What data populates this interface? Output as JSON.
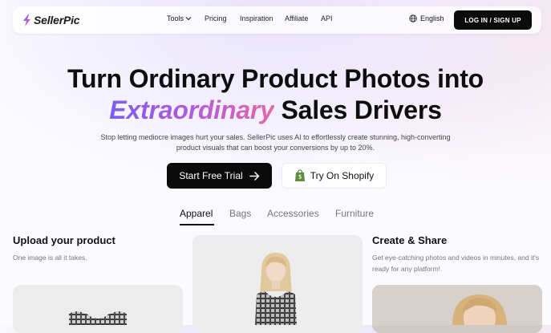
{
  "brand": {
    "name": "SellerPic",
    "accent": "#7b5cf0"
  },
  "nav": {
    "tools": "Tools",
    "pricing": "Pricing",
    "inspiration": "Inspiration",
    "affiliate": "Affiliate",
    "api": "API",
    "language": "English",
    "login": "LOG IN / SIGN UP"
  },
  "hero": {
    "line1": "Turn Ordinary Product Photos into",
    "highlight": "Extraordinary",
    "line2_rest": "Sales Drivers",
    "subtitle": "Stop letting mediocre images hurt your sales. SellerPic uses AI to effortlessly create stunning, high-converting product visuals that can boost your conversions by up to 20%.",
    "primary_cta": "Start Free Trial",
    "secondary_cta": "Try On Shopify"
  },
  "tabs": [
    {
      "label": "Apparel",
      "active": true
    },
    {
      "label": "Bags",
      "active": false
    },
    {
      "label": "Accessories",
      "active": false
    },
    {
      "label": "Furniture",
      "active": false
    }
  ],
  "steps": {
    "upload": {
      "title": "Upload your product",
      "text": "One image is all it takes."
    },
    "create": {
      "title": "Create & Share",
      "text": "Get eye-catching photos and videos in minutes, and it's ready for any platform!"
    }
  }
}
